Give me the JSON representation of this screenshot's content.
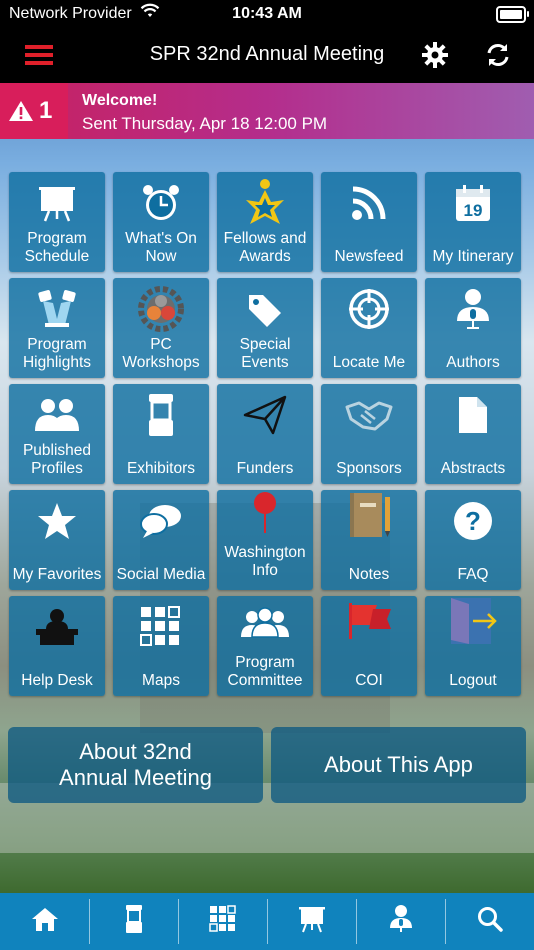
{
  "status_bar": {
    "carrier": "Network Provider",
    "time": "10:43 AM"
  },
  "nav": {
    "title": "SPR 32nd Annual Meeting"
  },
  "alert": {
    "count": "1",
    "heading": "Welcome!",
    "sent": "Sent Thursday, Apr 18 12:00 PM"
  },
  "tiles": [
    {
      "label": "Program Schedule",
      "icon": "presentation-board-icon"
    },
    {
      "label": "What's On Now",
      "icon": "alarm-clock-icon"
    },
    {
      "label": "Fellows and Awards",
      "icon": "star-person-icon"
    },
    {
      "label": "Newsfeed",
      "icon": "rss-icon"
    },
    {
      "label": "My Itinerary",
      "icon": "calendar-icon"
    },
    {
      "label": "Program Highlights",
      "icon": "spotlights-icon"
    },
    {
      "label": "PC Workshops",
      "icon": "gears-icon"
    },
    {
      "label": "Special Events",
      "icon": "tag-icon"
    },
    {
      "label": "Locate Me",
      "icon": "crosshair-icon"
    },
    {
      "label": "Authors",
      "icon": "speaker-icon"
    },
    {
      "label": "Published Profiles",
      "icon": "people-icon"
    },
    {
      "label": "Exhibitors",
      "icon": "booth-icon"
    },
    {
      "label": "Funders",
      "icon": "paper-plane-icon"
    },
    {
      "label": "Sponsors",
      "icon": "handshake-icon"
    },
    {
      "label": "Abstracts",
      "icon": "document-icon"
    },
    {
      "label": "My Favorites",
      "icon": "star-icon"
    },
    {
      "label": "Social Media",
      "icon": "chat-bubbles-icon"
    },
    {
      "label": "Washington Info",
      "icon": "map-pin-icon"
    },
    {
      "label": "Notes",
      "icon": "notebook-icon"
    },
    {
      "label": "FAQ",
      "icon": "question-icon"
    },
    {
      "label": "Help Desk",
      "icon": "help-desk-icon"
    },
    {
      "label": "Maps",
      "icon": "qr-map-icon"
    },
    {
      "label": "Program Committee",
      "icon": "committee-icon"
    },
    {
      "label": "COI",
      "icon": "flag-icon"
    },
    {
      "label": "Logout",
      "icon": "logout-door-icon"
    }
  ],
  "buttons": {
    "about_meeting": "About 32nd Annual Meeting",
    "about_app": "About This App"
  },
  "tabbar": [
    "home-icon",
    "booth-icon",
    "grid-icon",
    "presentation-board-icon",
    "speaker-icon",
    "search-icon"
  ]
}
